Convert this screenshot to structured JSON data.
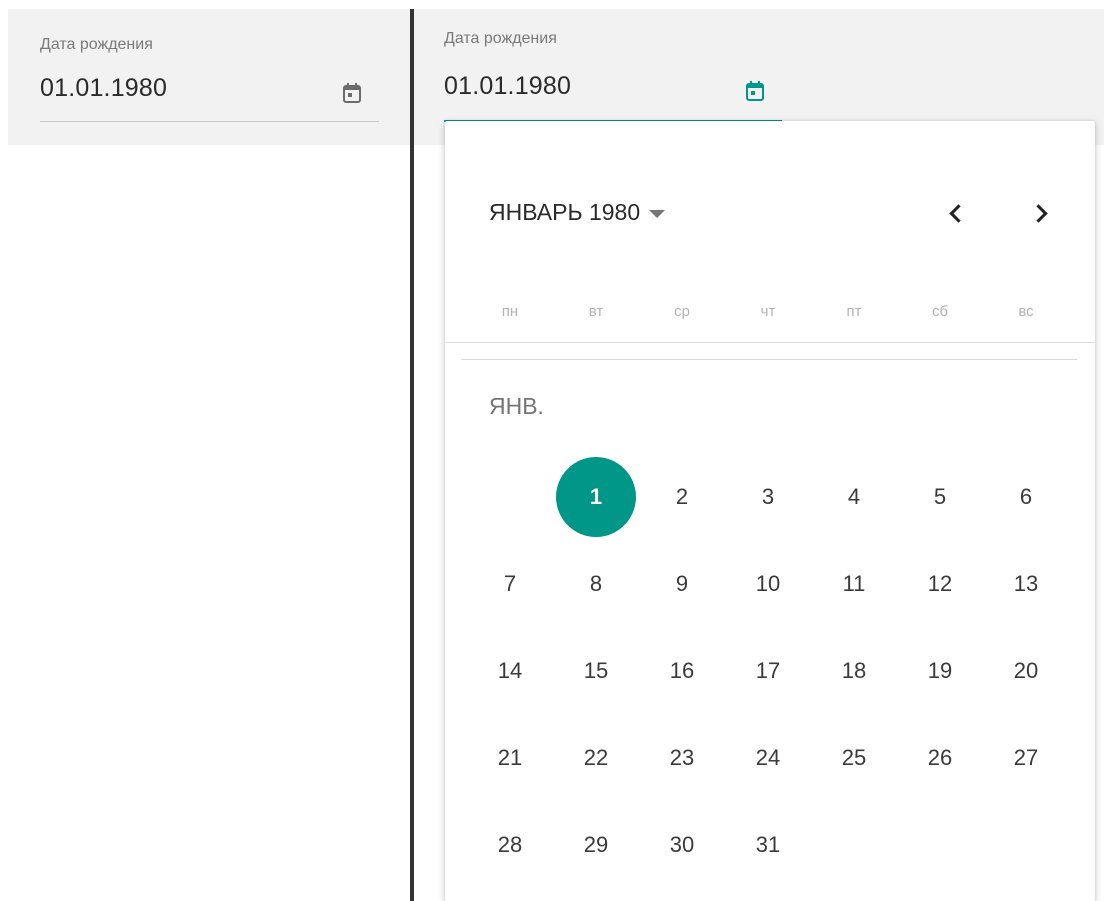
{
  "left_panel": {
    "field_label": "Дата рождения",
    "field_value": "01.01.1980",
    "icon": "calendar-icon"
  },
  "right_panel": {
    "field_label": "Дата рождения",
    "field_value": "01.01.1980",
    "icon": "calendar-icon"
  },
  "picker": {
    "month_year_label": "ЯНВАРЬ 1980",
    "prev_icon": "chevron-left-icon",
    "next_icon": "chevron-right-icon",
    "dropdown_icon": "caret-down-icon",
    "weekdays": [
      "пн",
      "вт",
      "ср",
      "чт",
      "пт",
      "сб",
      "вс"
    ],
    "month_short_label": "ЯНВ.",
    "first_weekday_offset": 1,
    "days": [
      "1",
      "2",
      "3",
      "4",
      "5",
      "6",
      "7",
      "8",
      "9",
      "10",
      "11",
      "12",
      "13",
      "14",
      "15",
      "16",
      "17",
      "18",
      "19",
      "20",
      "21",
      "22",
      "23",
      "24",
      "25",
      "26",
      "27",
      "28",
      "29",
      "30",
      "31"
    ],
    "selected_day": "1"
  },
  "colors": {
    "accent": "#009688",
    "field_background": "#f2f2f2",
    "divider": "#333333",
    "icon_inactive": "#6b6b6b"
  }
}
